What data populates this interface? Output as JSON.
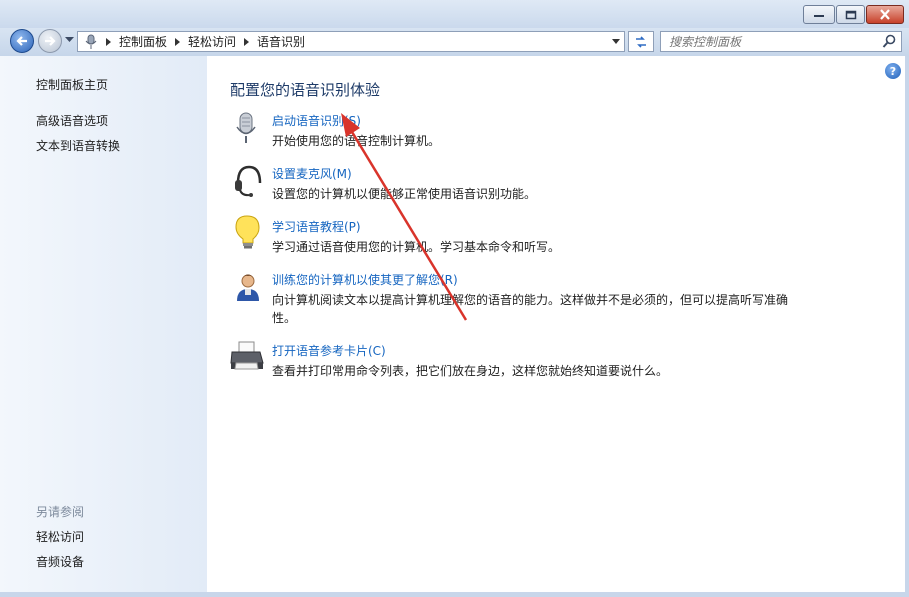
{
  "window": {
    "minimize_icon": "minimize-icon",
    "maximize_icon": "maximize-icon",
    "close_icon": "close-icon"
  },
  "address_bar": {
    "breadcrumbs": [
      "控制面板",
      "轻松访问",
      "语音识别"
    ],
    "search_placeholder": "搜索控制面板"
  },
  "sidebar": {
    "home_link": "控制面板主页",
    "links": [
      "高级语音选项",
      "文本到语音转换"
    ],
    "see_also_heading": "另请参阅",
    "see_also_links": [
      "轻松访问",
      "音频设备"
    ]
  },
  "main": {
    "heading": "配置您的语音识别体验",
    "items": [
      {
        "icon": "microphone-icon",
        "link": "启动语音识别(S)",
        "desc": "开始使用您的语音控制计算机。"
      },
      {
        "icon": "headset-icon",
        "link": "设置麦克风(M)",
        "desc": "设置您的计算机以便能够正常使用语音识别功能。"
      },
      {
        "icon": "lightbulb-icon",
        "link": "学习语音教程(P)",
        "desc": "学习通过语音使用您的计算机。学习基本命令和听写。"
      },
      {
        "icon": "user-speech-icon",
        "link": "训练您的计算机以使其更了解您(R)",
        "desc": "向计算机阅读文本以提高计算机理解您的语音的能力。这样做并不是必须的，但可以提高听写准确性。"
      },
      {
        "icon": "printer-icon",
        "link": "打开语音参考卡片(C)",
        "desc": "查看并打印常用命令列表，把它们放在身边，这样您就始终知道要说什么。"
      }
    ]
  },
  "colors": {
    "link": "#1565c0",
    "heading": "#1e3b68",
    "annotation_arrow": "#d9342b"
  }
}
